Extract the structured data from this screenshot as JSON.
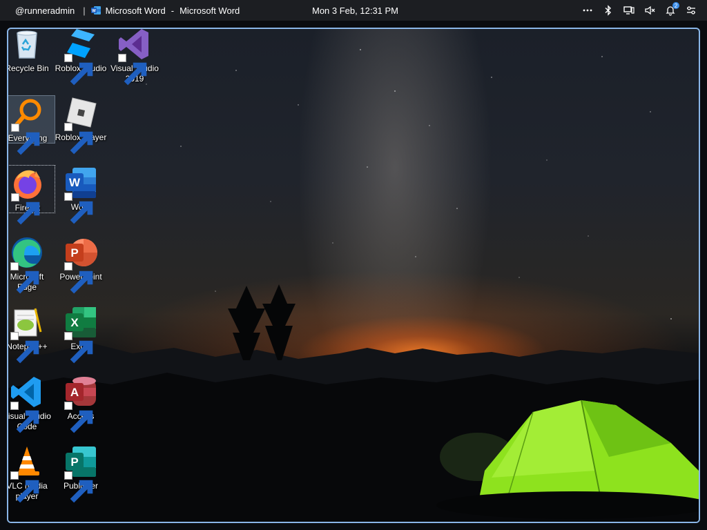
{
  "topbar": {
    "user": "@runneradmin",
    "separator": "|",
    "app_title": "Microsoft Word",
    "dash": "-",
    "window_title": "Microsoft Word",
    "datetime": "Mon 3 Feb, 12:31 PM",
    "notification_count": "2",
    "icons": [
      "more-icon",
      "bluetooth-icon",
      "display-icon",
      "volume-muted-icon",
      "notification-bell-icon",
      "settings-sliders-icon"
    ]
  },
  "desktop": {
    "icons": [
      {
        "id": "recycle-bin",
        "label": "Recycle Bin"
      },
      {
        "id": "roblox-studio",
        "label": "Roblox Studio"
      },
      {
        "id": "visual-studio-2019",
        "label": "Visual Studio 2019"
      },
      {
        "id": "everything",
        "label": "Everything"
      },
      {
        "id": "roblox-player",
        "label": "Roblox Player"
      },
      {
        "id": "firefox",
        "label": "Firefox"
      },
      {
        "id": "word",
        "label": "Word"
      },
      {
        "id": "microsoft-edge",
        "label": "Microsoft Edge"
      },
      {
        "id": "powerpoint",
        "label": "PowerPoint"
      },
      {
        "id": "notepad-plus-plus",
        "label": "Notepad++"
      },
      {
        "id": "excel",
        "label": "Excel"
      },
      {
        "id": "visual-studio-code",
        "label": "Visual Studio Code"
      },
      {
        "id": "access",
        "label": "Access"
      },
      {
        "id": "vlc-media-player",
        "label": "VLC media player"
      },
      {
        "id": "publisher",
        "label": "Publisher"
      }
    ]
  },
  "colors": {
    "topbar_bg": "#1c1e22",
    "desktop_border": "#8ab6e8",
    "word_blue": "#2b579a",
    "excel_green": "#217346",
    "powerpoint_orange": "#d24726",
    "access_red": "#a4373a",
    "publisher_teal": "#077568",
    "tent_green": "#8ee21e"
  }
}
